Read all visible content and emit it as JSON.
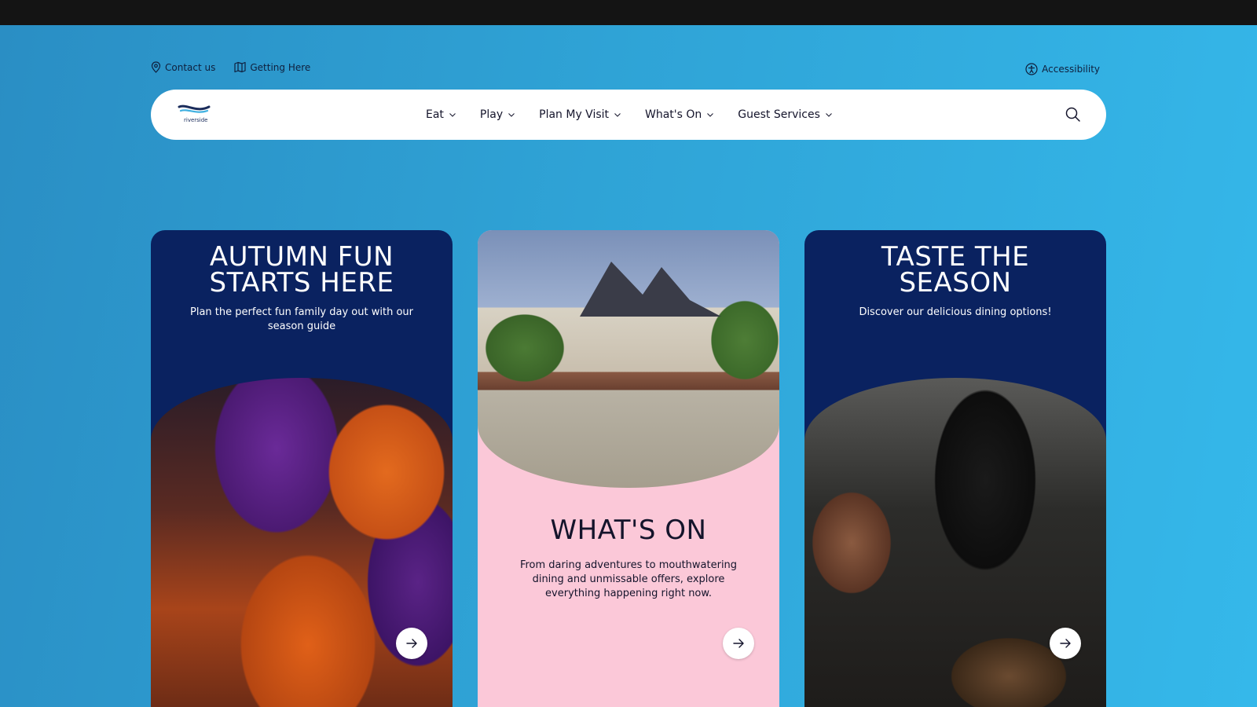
{
  "utility": {
    "contact_label": "Contact us",
    "getting_here_label": "Getting Here",
    "accessibility_label": "Accessibility"
  },
  "logo": {
    "text": "riverside"
  },
  "nav": {
    "items": [
      {
        "label": "Eat"
      },
      {
        "label": "Play"
      },
      {
        "label": "Plan My Visit"
      },
      {
        "label": "What's On"
      },
      {
        "label": "Guest Services"
      }
    ]
  },
  "cards": [
    {
      "title": "AUTUMN FUN\nSTARTS HERE",
      "desc": "Plan the perfect fun family day out with our season guide"
    },
    {
      "title": "WHAT'S ON",
      "desc": "From daring adventures to mouthwatering dining and unmissable offers, explore everything happening right now."
    },
    {
      "title": "TASTE THE\nSEASON",
      "desc": "Discover our delicious dining options!"
    }
  ],
  "colors": {
    "navy": "#0a2260",
    "pink": "#fbc8d8",
    "topbar": "#141414"
  }
}
